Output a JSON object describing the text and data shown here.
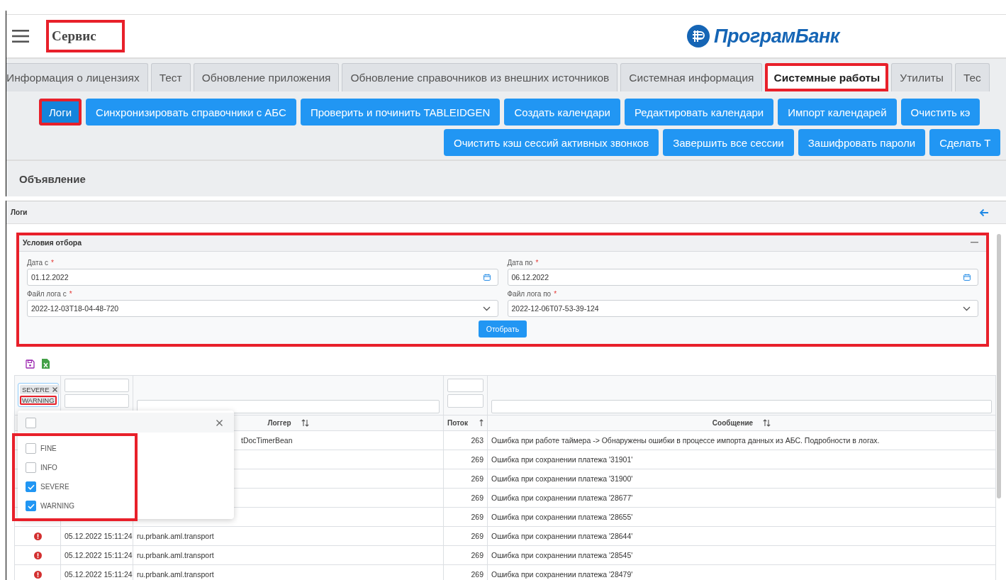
{
  "header": {
    "title": "Сервис",
    "title_highlighted": true,
    "logo_text": "ПрограмБанк"
  },
  "tabs": [
    {
      "label": "Информация о лицензиях",
      "selected": false,
      "highlighted": false
    },
    {
      "label": "Тест",
      "selected": false,
      "highlighted": false
    },
    {
      "label": "Обновление приложения",
      "selected": false,
      "highlighted": false
    },
    {
      "label": "Обновление справочников из внешних источников",
      "selected": false,
      "highlighted": false
    },
    {
      "label": "Системная информация",
      "selected": false,
      "highlighted": false
    },
    {
      "label": "Системные работы",
      "selected": true,
      "highlighted": true
    },
    {
      "label": "Утилиты",
      "selected": false,
      "highlighted": false
    },
    {
      "label": "Тес",
      "selected": false,
      "highlighted": false
    }
  ],
  "action_rows": [
    [
      {
        "label": "Логи",
        "active": true,
        "highlighted": true
      },
      {
        "label": "Синхронизировать справочники с АБС",
        "active": false,
        "highlighted": false
      },
      {
        "label": "Проверить и починить TABLEIDGEN",
        "active": false,
        "highlighted": false
      },
      {
        "label": "Создать календари",
        "active": false,
        "highlighted": false
      },
      {
        "label": "Редактировать календари",
        "active": false,
        "highlighted": false
      },
      {
        "label": "Импорт календарей",
        "active": false,
        "highlighted": false
      },
      {
        "label": "Очистить кэ",
        "active": false,
        "highlighted": false
      }
    ],
    [
      {
        "label": "Очистить кэш сессий активных звонков",
        "active": false,
        "highlighted": false
      },
      {
        "label": "Завершить все сессии",
        "active": false,
        "highlighted": false
      },
      {
        "label": "Зашифровать пароли",
        "active": false,
        "highlighted": false
      },
      {
        "label": "Сделать Т",
        "active": false,
        "highlighted": false
      }
    ]
  ],
  "announcement": {
    "title": "Объявление"
  },
  "logs_panel": {
    "title": "Логи",
    "filter": {
      "title": "Условия отбора",
      "highlighted": true,
      "fields": [
        {
          "kind": "date",
          "label": "Дата с",
          "required_mark": "*",
          "value": "01.12.2022"
        },
        {
          "kind": "date",
          "label": "Дата по",
          "required_mark": "*",
          "value": "06.12.2022"
        },
        {
          "kind": "select",
          "label": "Файл лога с",
          "required_mark": "*",
          "value": "2022-12-03T18-04-48-720"
        },
        {
          "kind": "select",
          "label": "Файл лога по",
          "required_mark": "*",
          "value": "2022-12-06T07-53-39-124"
        }
      ],
      "submit": "Отобрать"
    }
  },
  "table": {
    "level_filter": {
      "highlighted": true,
      "select_all": {
        "checked": false
      },
      "chips": [
        {
          "label": "SEVERE",
          "removable": true,
          "highlighted": false
        },
        {
          "label": "WARNING",
          "removable": false,
          "highlighted": true
        }
      ],
      "options": [
        {
          "label": "FINE",
          "checked": false
        },
        {
          "label": "INFO",
          "checked": false
        },
        {
          "label": "SEVERE",
          "checked": true
        },
        {
          "label": "WARNING",
          "checked": true
        }
      ]
    },
    "columns": [
      {
        "label": "Логгер",
        "kind": "sortable"
      },
      {
        "label": "Поток",
        "kind": "sorted"
      },
      {
        "label": "Сообщение",
        "kind": "sortable"
      }
    ],
    "rows": [
      {
        "covered": true,
        "logger": "tDocTimerBean",
        "thread": "263",
        "message": "Ошибка при работе таймера -> Обнаружены ошибки в процессе импорта данных из АБС. Подробности в логах."
      },
      {
        "thread": "269",
        "message": "Ошибка при сохранении платежа '31901'"
      },
      {
        "thread": "269",
        "message": "Ошибка при сохранении платежа '31900'"
      },
      {
        "thread": "269",
        "message": "Ошибка при сохранении платежа '28677'"
      },
      {
        "thread": "269",
        "message": "Ошибка при сохранении платежа '28655'"
      },
      {
        "covered": false,
        "kind": "error",
        "date": "05.12.2022 15:11:24",
        "logger": "ru.prbank.aml.transport",
        "thread": "269",
        "message": "Ошибка при сохранении платежа '28644'"
      },
      {
        "covered": false,
        "kind": "error",
        "date": "05.12.2022 15:11:24",
        "logger": "ru.prbank.aml.transport",
        "thread": "269",
        "message": "Ошибка при сохранении платежа '28545'"
      },
      {
        "covered": false,
        "kind": "error",
        "date": "05.12.2022 15:11:24",
        "logger": "ru.prbank.aml.transport",
        "thread": "269",
        "message": "Ошибка при сохранении платежа '28479'"
      }
    ]
  }
}
